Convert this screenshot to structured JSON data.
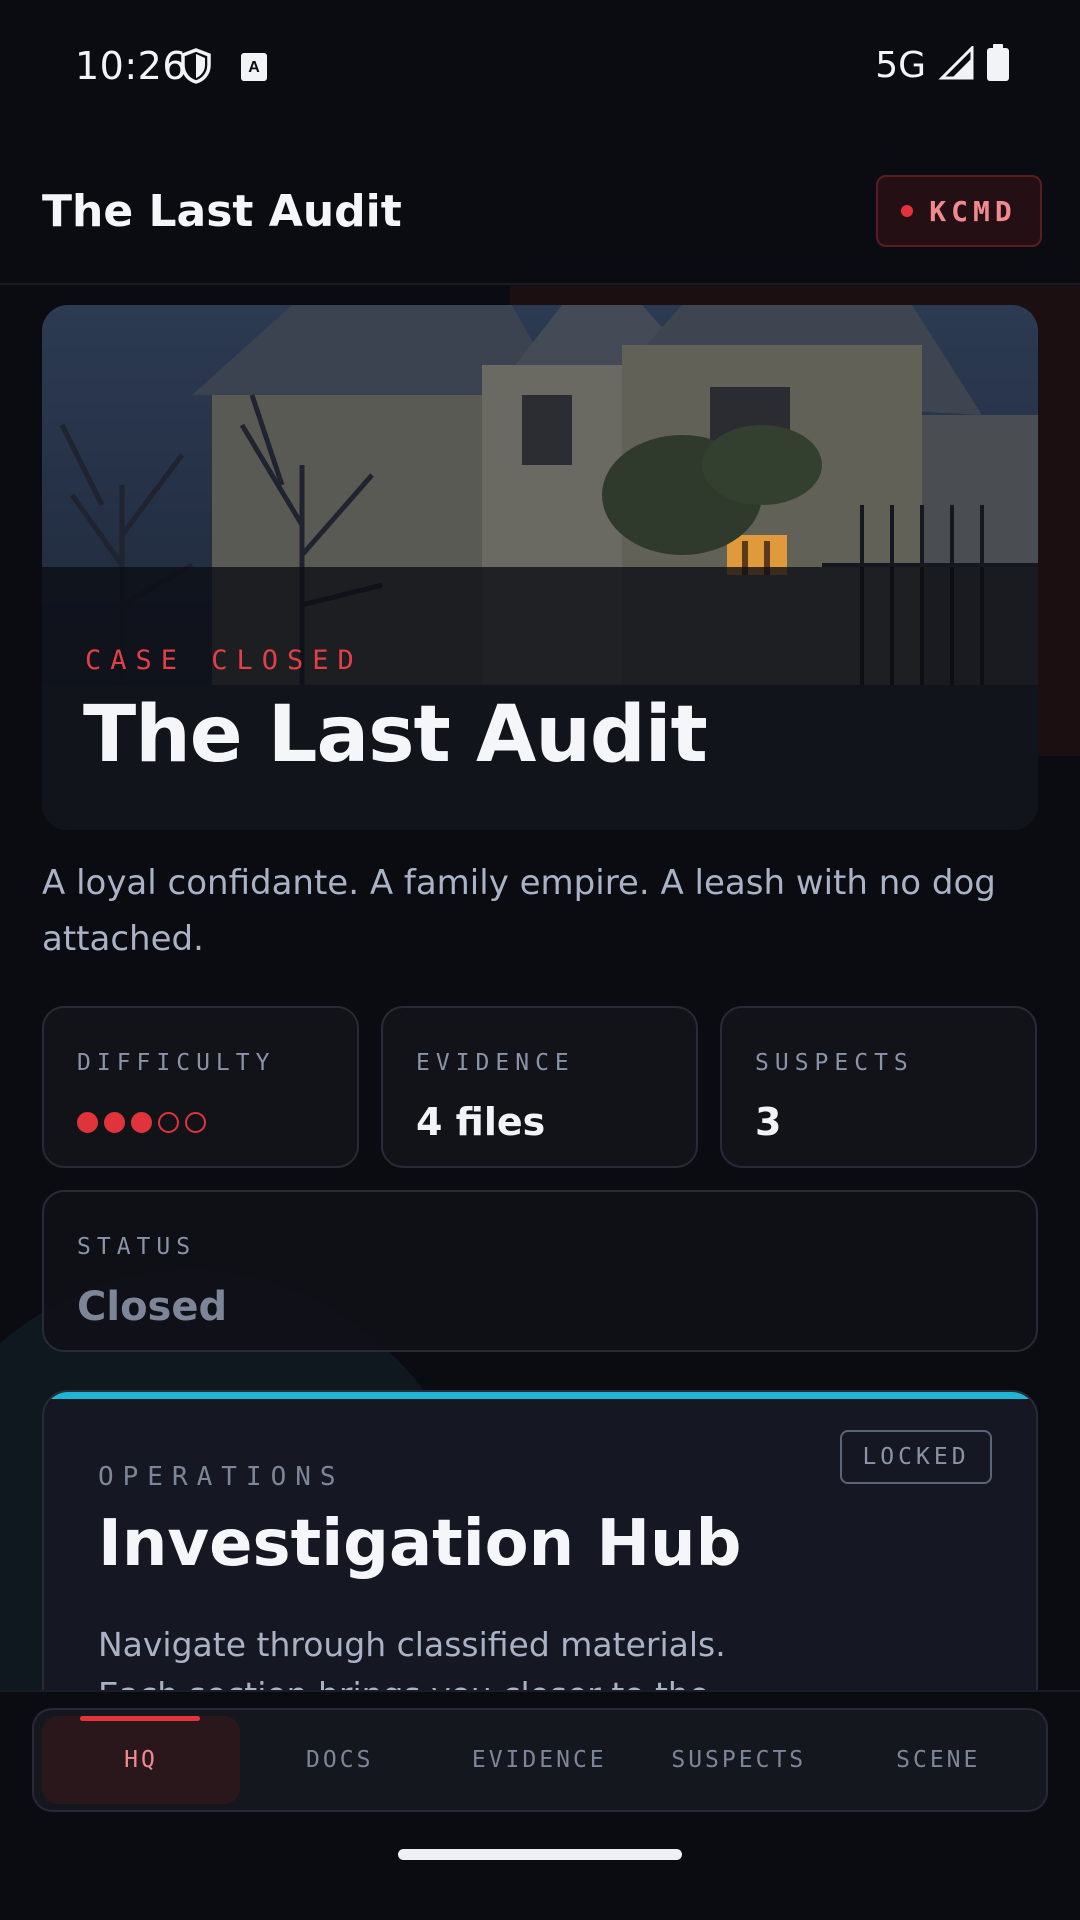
{
  "status_bar": {
    "time": "10:26",
    "network": "5G",
    "icons": [
      "shield-icon",
      "app-notification-icon",
      "signal-icon",
      "battery-icon"
    ]
  },
  "app_bar": {
    "title": "The Last Audit",
    "badge_label": "KCMD"
  },
  "hero": {
    "kicker": "CASE CLOSED",
    "title": "The Last Audit",
    "image": "stone-manor-at-night"
  },
  "tagline": "A loyal confidante. A family empire. A leash with no dog attached.",
  "stats": {
    "difficulty": {
      "label": "DIFFICULTY",
      "level": 3,
      "max": 5
    },
    "evidence": {
      "label": "EVIDENCE",
      "value": "4 files"
    },
    "suspects": {
      "label": "SUSPECTS",
      "value": "3"
    },
    "status": {
      "label": "STATUS",
      "value": "Closed"
    }
  },
  "operations": {
    "kicker": "OPERATIONS",
    "badge": "LOCKED",
    "title": "Investigation Hub",
    "description": "Navigate through classified materials. Each section brings you closer to the"
  },
  "nav": {
    "tabs": [
      {
        "label": "HQ",
        "active": true
      },
      {
        "label": "DOCS",
        "active": false
      },
      {
        "label": "EVIDENCE",
        "active": false
      },
      {
        "label": "SUSPECTS",
        "active": false
      },
      {
        "label": "SCENE",
        "active": false
      }
    ]
  },
  "colors": {
    "accent_red": "#e5333b",
    "accent_teal": "#1fb6d6",
    "background": "#0b0c12",
    "card": "#121319"
  }
}
